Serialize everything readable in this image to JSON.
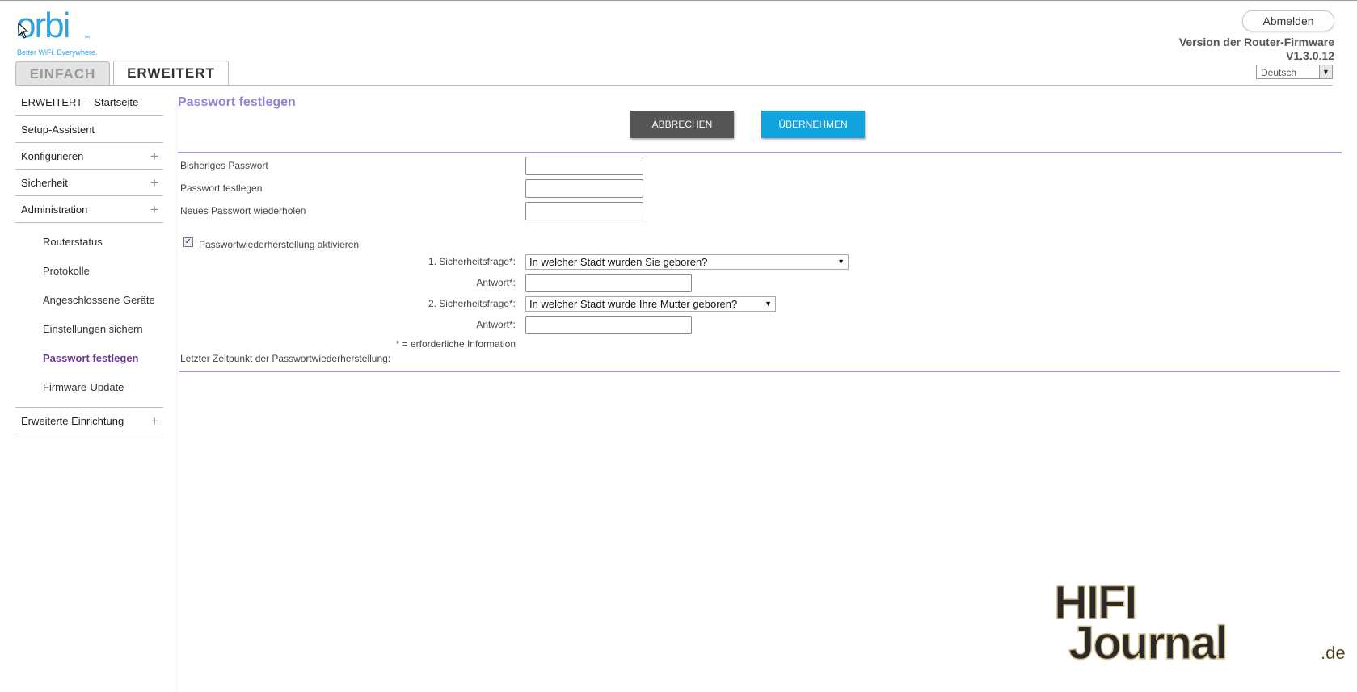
{
  "logo": {
    "word": "orbi",
    "tm": "™",
    "tagline": "Better WiFi. Everywhere."
  },
  "header": {
    "logout_label": "Abmelden",
    "firmware_label": "Version der Router-Firmware",
    "firmware_version": "V1.3.0.12",
    "language_selected": "Deutsch"
  },
  "tabs": [
    {
      "label": "EINFACH",
      "active": false
    },
    {
      "label": "ERWEITERT",
      "active": true
    }
  ],
  "sidebar": {
    "items": [
      {
        "label": "ERWEITERT – Startseite"
      },
      {
        "label": "Setup-Assistent"
      },
      {
        "label": "Konfigurieren",
        "expand": "+"
      },
      {
        "label": "Sicherheit",
        "expand": "+"
      },
      {
        "label": "Administration",
        "expand": "+"
      }
    ],
    "sub_items": [
      {
        "label": "Routerstatus"
      },
      {
        "label": "Protokolle"
      },
      {
        "label": "Angeschlossene Geräte"
      },
      {
        "label": "Einstellungen sichern"
      },
      {
        "label": "Passwort festlegen",
        "active": true
      },
      {
        "label": "Firmware-Update"
      }
    ],
    "bottom_item": {
      "label": "Erweiterte Einrichtung",
      "expand": "+"
    }
  },
  "main": {
    "title": "Passwort festlegen",
    "cancel_label": "ABBRECHEN",
    "apply_label": "ÜBERNEHMEN",
    "fields": {
      "old_password": "Bisheriges Passwort",
      "new_password": "Passwort festlegen",
      "repeat_password": "Neues Passwort wiederholen"
    },
    "recovery_checkbox_label": "Passwortwiederherstellung aktivieren",
    "recovery_checked": true,
    "question1_label": "1. Sicherheitsfrage*:",
    "question1_value": "In welcher Stadt wurden Sie geboren?",
    "answer1_label": "Antwort*:",
    "question2_label": "2. Sicherheitsfrage*:",
    "question2_value": "In welcher Stadt wurde Ihre Mutter geboren?",
    "answer2_label": "Antwort*:",
    "required_note": "* = erforderliche Information",
    "last_recovery_label": "Letzter Zeitpunkt der Passwortwiederherstellung:"
  },
  "watermark": {
    "part1": "HIFI",
    "part2": "Journal",
    "suffix": ".de"
  },
  "colors": {
    "brand": "#2fa4dc",
    "title": "#8b87d6",
    "apply": "#11a4de",
    "cancel": "#555555",
    "active_nav": "#6a3c8f"
  }
}
